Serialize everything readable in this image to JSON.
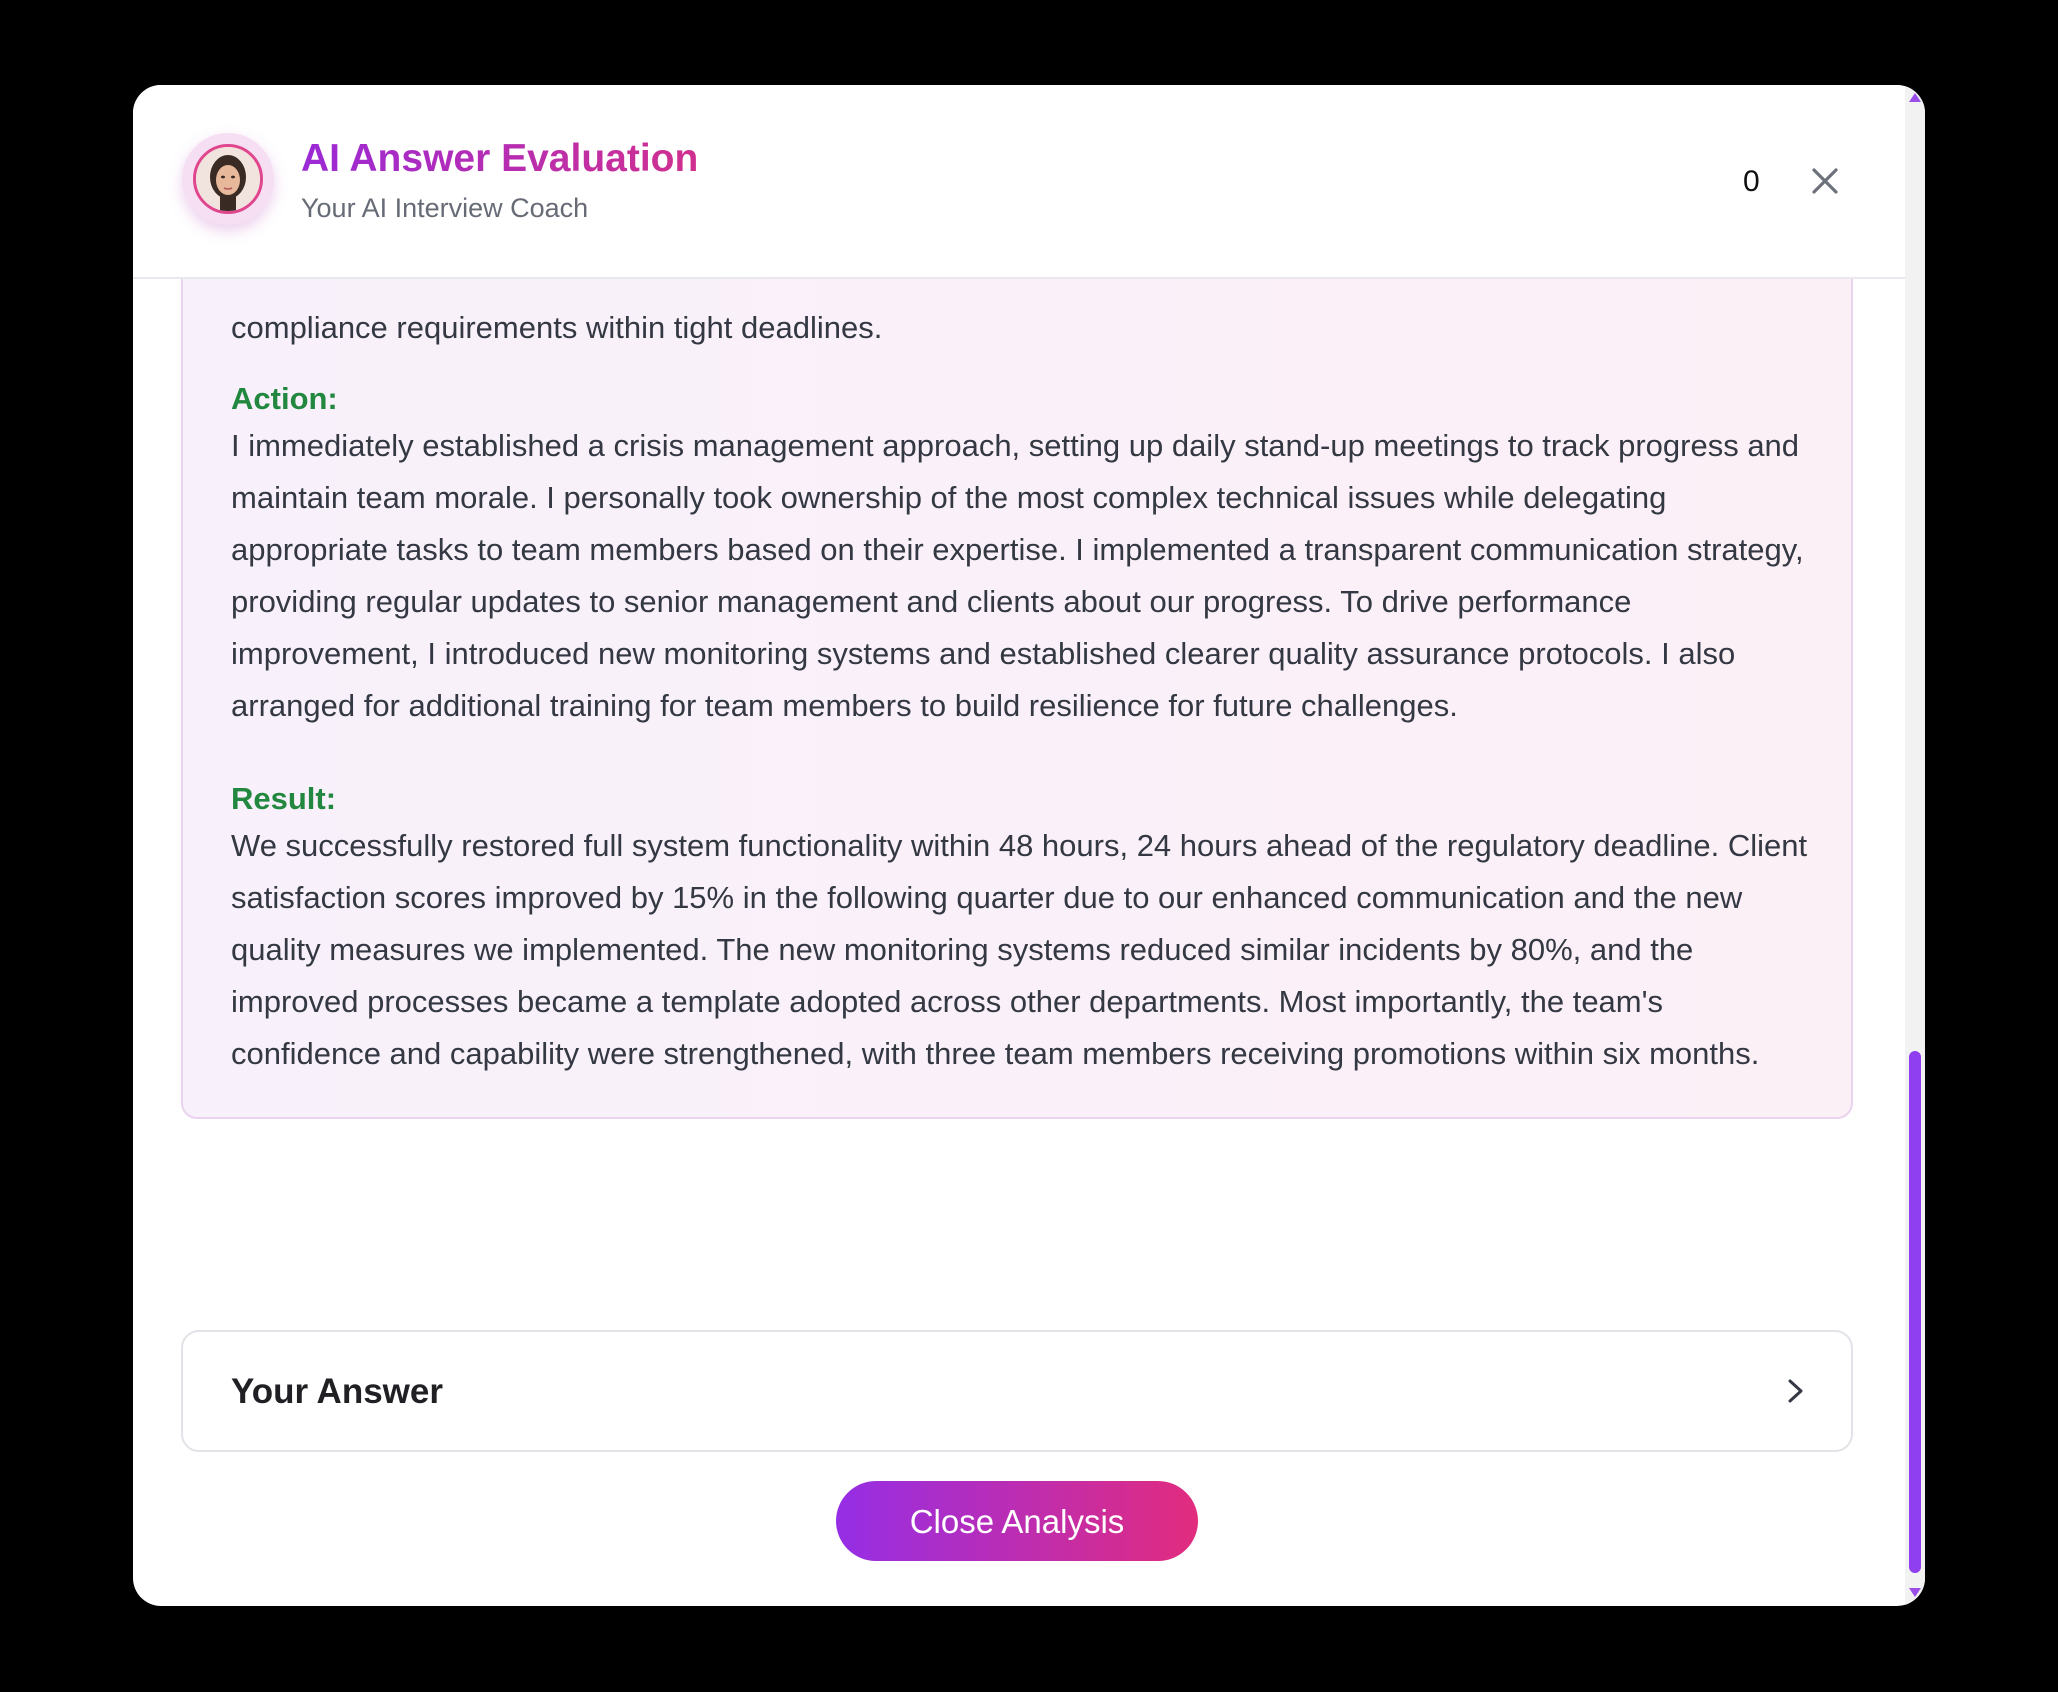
{
  "header": {
    "title": "AI Answer Evaluation",
    "subtitle": "Your AI Interview Coach",
    "counter": "0",
    "close_icon": "close-icon",
    "avatar": "coach-avatar"
  },
  "star": {
    "situation_tail": "compliance requirements within tight deadlines.",
    "action_label": "Action:",
    "action_text": "I immediately established a crisis management approach, setting up daily stand-up meetings to track progress and maintain team morale. I personally took ownership of the most complex technical issues while delegating appropriate tasks to team members based on their expertise. I implemented a transparent communication strategy, providing regular updates to senior management and clients about our progress. To drive performance improvement, I introduced new monitoring systems and established clearer quality assurance protocols. I also arranged for additional training for team members to build resilience for future challenges.",
    "result_label": "Result:",
    "result_text": "We successfully restored full system functionality within 48 hours, 24 hours ahead of the regulatory deadline. Client satisfaction scores improved by 15% in the following quarter due to our enhanced communication and the new quality measures we implemented. The new monitoring systems reduced similar incidents by 80%, and the improved processes became a template adopted across other departments. Most importantly, the team's confidence and capability were strengthened, with three team members receiving promotions within six months."
  },
  "answer_section": {
    "title": "Your Answer",
    "icon": "chevron-right-icon"
  },
  "footer": {
    "close_button": "Close Analysis"
  },
  "colors": {
    "accent_purple": "#952ee6",
    "accent_pink": "#e22c7e",
    "label_green": "#23883f"
  }
}
